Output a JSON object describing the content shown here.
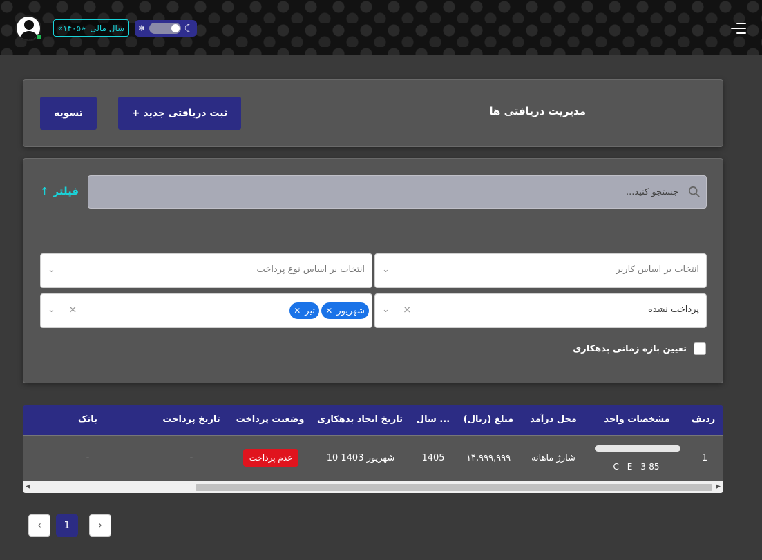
{
  "topbar": {
    "fiscal_year_label": "سال مالی",
    "fiscal_year_value": "«۱۴۰۵»",
    "theme_light_icon": "snowflake-icon",
    "theme_dark_icon": "moon-icon",
    "menu_icon": "hamburger-menu-icon"
  },
  "header": {
    "title": "مدیریت دریافتی ها",
    "new_button": "+ ثبت دریافتی جدید",
    "settle_button": "تسویه"
  },
  "filter": {
    "search_placeholder": "جستجو کنید...",
    "toggle_label": "فیلتر",
    "user_select_placeholder": "انتخاب بر اساس کاربر",
    "paytype_select_placeholder": "انتخاب بر اساس نوع پرداخت",
    "status_value": "پرداخت نشده",
    "month_chips": [
      "شهریور",
      "تیر"
    ],
    "debt_range_label": "تعیین بازه زمانی بدهکاری"
  },
  "table": {
    "headers": [
      "ردیف",
      "مشخصات واحد",
      "محل درآمد",
      "مبلغ (ریال)",
      "سال ...",
      "تاریخ ایجاد بدهکاری",
      "وضعیت پرداخت",
      "تاریخ پرداخت",
      "بانک"
    ],
    "rows": [
      {
        "row_no": "1",
        "unit_code": "C - E - 3-85",
        "income_source": "شارژ ماهانه",
        "amount": "۱۴,۹۹۹,۹۹۹",
        "year": "1405",
        "debt_created": "10 شهریور 1403",
        "payment_status": "عدم پرداخت",
        "payment_date": "-",
        "bank": "-"
      }
    ]
  },
  "pagination": {
    "current_page": "1"
  },
  "colors": {
    "accent": "#2c2c84",
    "cyan": "#19d3d9",
    "danger": "#e0141e",
    "chip": "#1a73e8",
    "online": "#1db954"
  }
}
